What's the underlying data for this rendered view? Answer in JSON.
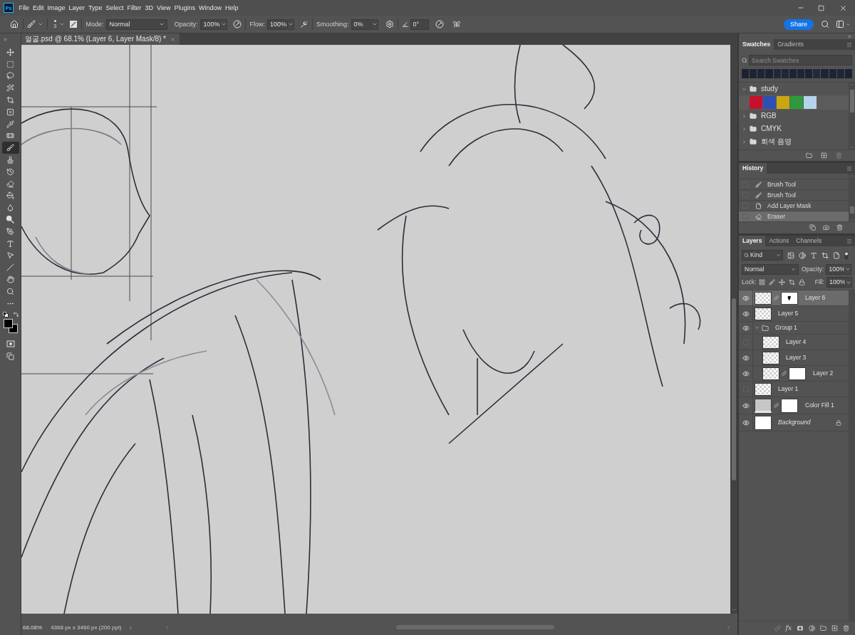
{
  "app_logo": "Ps",
  "menu_bar": {
    "items": [
      "File",
      "Edit",
      "Image",
      "Layer",
      "Type",
      "Select",
      "Filter",
      "3D",
      "View",
      "Plugins",
      "Window",
      "Help"
    ]
  },
  "options_bar": {
    "brush_size": "3",
    "mode_label": "Mode:",
    "mode": "Normal",
    "opacity_label": "Opacity:",
    "opacity": "100%",
    "flow_label": "Flow:",
    "flow": "100%",
    "smoothing_label": "Smoothing:",
    "smoothing": "0%",
    "angle": "0°",
    "share_button": "Share"
  },
  "document_tab": {
    "title": "얼굴.psd @ 68.1% (Layer 6, Layer Mask/8) *"
  },
  "tools": [
    {
      "kind": "move",
      "selected": false
    },
    {
      "kind": "marquee",
      "selected": false
    },
    {
      "kind": "lasso",
      "selected": false
    },
    {
      "kind": "quick_select",
      "selected": false
    },
    {
      "kind": "crop",
      "selected": false
    },
    {
      "kind": "frame",
      "selected": false
    },
    {
      "kind": "eyedropper",
      "selected": false
    },
    {
      "kind": "healing",
      "selected": false
    },
    {
      "kind": "brush",
      "selected": true
    },
    {
      "kind": "stamp",
      "selected": false
    },
    {
      "kind": "history_brush",
      "selected": false
    },
    {
      "kind": "eraser",
      "selected": false
    },
    {
      "kind": "bucket",
      "selected": false
    },
    {
      "kind": "smudge",
      "selected": false
    },
    {
      "kind": "dodge",
      "selected": false
    },
    {
      "kind": "pen",
      "selected": false
    },
    {
      "kind": "type",
      "selected": false
    },
    {
      "kind": "path_select",
      "selected": false
    },
    {
      "kind": "line",
      "selected": false
    },
    {
      "kind": "hand",
      "selected": false
    },
    {
      "kind": "zoom",
      "selected": false
    },
    {
      "kind": "more",
      "selected": false
    }
  ],
  "color_chips": [
    {
      "color": "#000000"
    },
    {
      "color": "#000000"
    }
  ],
  "swatches_panel": {
    "tabs": [
      {
        "label": "Swatches",
        "selected": true
      },
      {
        "label": "Gradients",
        "selected": false
      }
    ],
    "search": {
      "placeholder": "Search Swatches"
    },
    "recent": [
      {
        "color": "#1b2130"
      },
      {
        "color": "#1d2333"
      },
      {
        "color": "#1e2434"
      },
      {
        "color": "#1c2232"
      },
      {
        "color": "#20283a"
      },
      {
        "color": "#1f2636"
      },
      {
        "color": "#1d2434"
      },
      {
        "color": "#1e2535"
      },
      {
        "color": "#1c2333"
      },
      {
        "color": "#222a3b"
      },
      {
        "color": "#1e2536"
      },
      {
        "color": "#1d2434"
      },
      {
        "color": "#1f2637"
      },
      {
        "color": "#1c2232"
      }
    ],
    "groups": [
      {
        "name": "study",
        "expanded": true,
        "swatches": [
          {
            "color": "#c8102e"
          },
          {
            "color": "#2d4fb3"
          },
          {
            "color": "#c9a711"
          },
          {
            "color": "#2f9a3c"
          },
          {
            "color": "#b5d3ec"
          }
        ]
      },
      {
        "name": "RGB",
        "expanded": false
      },
      {
        "name": "CMYK",
        "expanded": false
      },
      {
        "name": "회색 음영",
        "expanded": false
      }
    ]
  },
  "history_panel": {
    "tabs": [
      {
        "label": "History",
        "selected": true
      }
    ],
    "items": [
      {
        "label": "Brush Tool",
        "kind": "brush",
        "selected": false
      },
      {
        "label": "Brush Tool",
        "kind": "brush",
        "selected": false
      },
      {
        "label": "Add Layer Mask",
        "kind": "mask",
        "selected": false
      },
      {
        "label": "Eraser",
        "kind": "eraser",
        "selected": true
      }
    ]
  },
  "layers_panel": {
    "tabs": [
      {
        "label": "Layers",
        "selected": true
      },
      {
        "label": "Actions",
        "selected": false
      },
      {
        "label": "Channels",
        "selected": false
      }
    ],
    "filter": "Kind",
    "blend_mode": "Normal",
    "opacity_label": "Opacity:",
    "opacity": "100%",
    "lock_label": "Lock:",
    "fill_label": "Fill:",
    "fill": "100%",
    "layers": [
      {
        "name": "Layer 6",
        "kind": "pixel",
        "visible": true,
        "selected": true,
        "mask": true,
        "mask_painted": true
      },
      {
        "name": "Layer 5",
        "kind": "pixel",
        "visible": true,
        "selected": false
      },
      {
        "name": "Group 1",
        "kind": "group",
        "visible": true,
        "selected": false,
        "expanded": true,
        "children": [
          {
            "name": "Layer 4",
            "kind": "pixel",
            "visible": false,
            "selected": false
          },
          {
            "name": "Layer 3",
            "kind": "pixel",
            "visible": true,
            "selected": false
          },
          {
            "name": "Layer 2",
            "kind": "pixel",
            "visible": true,
            "selected": false,
            "mask": true,
            "mask_painted": false
          }
        ]
      },
      {
        "name": "Layer 1",
        "kind": "pixel",
        "visible": false,
        "selected": false
      },
      {
        "name": "Color Fill 1",
        "kind": "fill",
        "visible": true,
        "selected": false,
        "mask": true,
        "mask_painted": false
      },
      {
        "name": "Background",
        "kind": "background",
        "visible": true,
        "selected": false,
        "locked": true
      }
    ],
    "footer_fx": "fx"
  },
  "status_bar": {
    "zoom": "68.08%",
    "document_size": "4368 px x 3460 px (200 ppi)"
  }
}
